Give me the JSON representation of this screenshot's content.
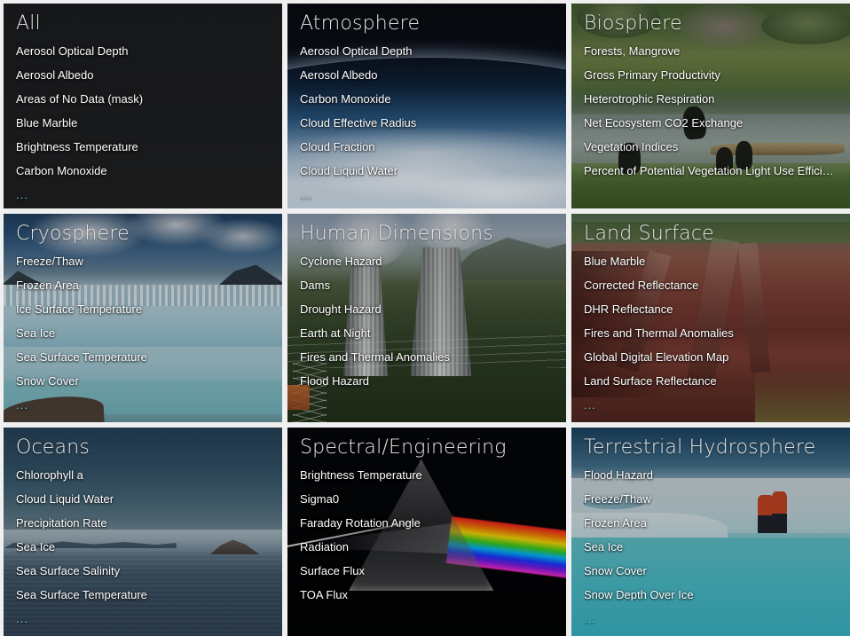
{
  "page": {
    "background_color": "#f0f0f0",
    "layout": "3x3-card-grid",
    "more_indicator": "..."
  },
  "cards": [
    {
      "title": "All",
      "art": "flat-dark",
      "items": [
        "Aerosol Optical Depth",
        "Aerosol Albedo",
        "Areas of No Data (mask)",
        "Blue Marble",
        "Brightness Temperature",
        "Carbon Monoxide"
      ],
      "has_more": true,
      "more": "..."
    },
    {
      "title": "Atmosphere",
      "art": "earth-limb-clouds-photo",
      "items": [
        "Aerosol Optical Depth",
        "Aerosol Albedo",
        "Carbon Monoxide",
        "Cloud Effective Radius",
        "Cloud Fraction",
        "Cloud Liquid Water"
      ],
      "has_more": true,
      "more": "..."
    },
    {
      "title": "Biosphere",
      "art": "wetland-river-wildlife-photo",
      "items": [
        "Forests, Mangrove",
        "Gross Primary Productivity",
        "Heterotrophic Respiration",
        "Net Ecosystem CO2 Exchange",
        "Vegetation Indices",
        "Percent of Potential Vegetation Light Use Efficiency"
      ],
      "has_more": false,
      "more": ""
    },
    {
      "title": "Cryosphere",
      "art": "glacier-photo",
      "items": [
        "Freeze/Thaw",
        "Frozen Area",
        "Ice Surface Temperature",
        "Sea Ice",
        "Sea Surface Temperature",
        "Snow Cover"
      ],
      "has_more": true,
      "more": "..."
    },
    {
      "title": "Human Dimensions",
      "art": "cooling-towers-photo",
      "items": [
        "Cyclone Hazard",
        "Dams",
        "Drought Hazard",
        "Earth at Night",
        "Fires and Thermal Anomalies",
        "Flood Hazard"
      ],
      "has_more": false,
      "more": ""
    },
    {
      "title": "Land Surface",
      "art": "eroded-red-canyon-photo",
      "items": [
        "Blue Marble",
        "Corrected Reflectance",
        "DHR Reflectance",
        "Fires and Thermal Anomalies",
        "Global Digital Elevation Map",
        "Land Surface Reflectance"
      ],
      "has_more": true,
      "more": "..."
    },
    {
      "title": "Oceans",
      "art": "calm-sea-island-photo",
      "items": [
        "Chlorophyll a",
        "Cloud Liquid Water",
        "Precipitation Rate",
        "Sea Ice",
        "Sea Surface Salinity",
        "Sea Surface Temperature"
      ],
      "has_more": true,
      "more": "..."
    },
    {
      "title": "Spectral/Engineering",
      "art": "prism-spectrum-photo",
      "items": [
        "Brightness Temperature",
        "Sigma0",
        "Faraday Rotation Angle",
        "Radiation",
        "Surface Flux",
        "TOA Flux"
      ],
      "has_more": false,
      "more": ""
    },
    {
      "title": "Terrestrial Hydrosphere",
      "art": "arctic-melt-pond-photo",
      "items": [
        "Flood Hazard",
        "Freeze/Thaw",
        "Frozen Area",
        "Sea Ice",
        "Snow Cover",
        "Snow Depth Over Ice"
      ],
      "has_more": true,
      "more": "..."
    }
  ]
}
